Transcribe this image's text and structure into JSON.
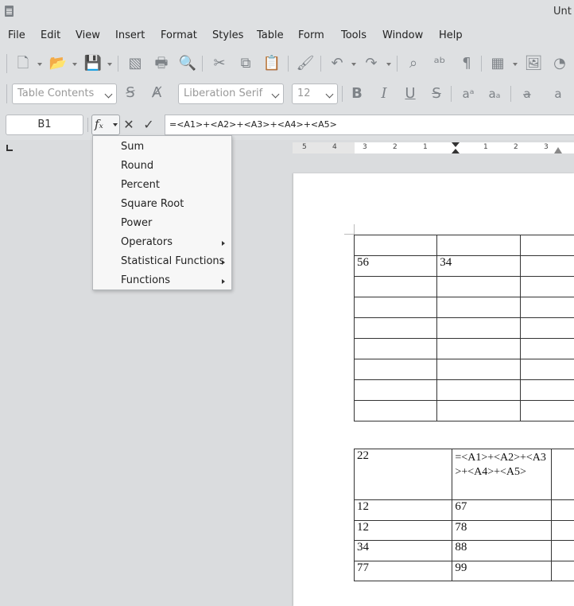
{
  "window": {
    "title": "Unt"
  },
  "menubar": [
    "File",
    "Edit",
    "View",
    "Insert",
    "Format",
    "Styles",
    "Table",
    "Form",
    "Tools",
    "Window",
    "Help"
  ],
  "toolbar": {
    "paragraph_style": "Table Contents",
    "font_name": "Liberation Serif",
    "font_size": "12"
  },
  "formula_bar": {
    "cell_reference": "B1",
    "formula": "=<A1>+<A2>+<A3>+<A4>+<A5>"
  },
  "ruler": {
    "labels": [
      "5",
      "4",
      "3",
      "2",
      "1",
      "1",
      "2",
      "3"
    ]
  },
  "formula_menu": {
    "items": [
      {
        "label": "Sum",
        "submenu": false
      },
      {
        "label": "Round",
        "submenu": false
      },
      {
        "label": "Percent",
        "submenu": false
      },
      {
        "label": "Square Root",
        "submenu": false
      },
      {
        "label": "Power",
        "submenu": false
      },
      {
        "label": "Operators",
        "submenu": true
      },
      {
        "label": "Statistical Functions",
        "submenu": true
      },
      {
        "label": "Functions",
        "submenu": true
      }
    ]
  },
  "table1": {
    "rows": [
      [
        "",
        "",
        ""
      ],
      [
        "56",
        "34",
        ""
      ],
      [
        "",
        "",
        ""
      ],
      [
        "",
        "",
        ""
      ],
      [
        "",
        "",
        ""
      ],
      [
        "",
        "",
        ""
      ],
      [
        "",
        "",
        ""
      ],
      [
        "",
        "",
        ""
      ],
      [
        "",
        "",
        ""
      ]
    ]
  },
  "table2": {
    "rows": [
      [
        "22",
        "=<A1>+<A2>+<A3>+<A4>+<A5>",
        ""
      ],
      [
        "12",
        "67",
        ""
      ],
      [
        "12",
        "78",
        ""
      ],
      [
        "34",
        "88",
        ""
      ],
      [
        "77",
        "99",
        ""
      ]
    ]
  }
}
